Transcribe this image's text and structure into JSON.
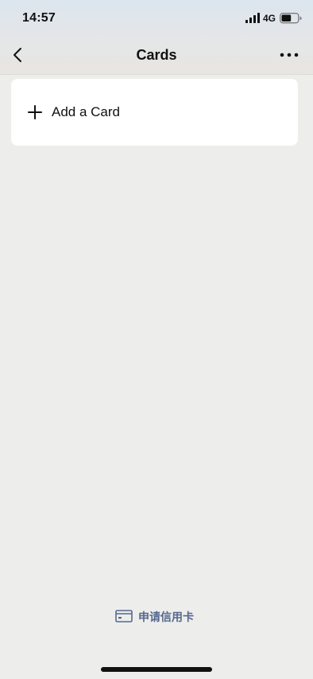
{
  "status_bar": {
    "time": "14:57",
    "network": "4G",
    "battery_level": 0.6
  },
  "nav": {
    "title": "Cards",
    "back_icon": "chevron-left-icon",
    "more_icon": "more-horizontal-icon"
  },
  "cards_panel": {
    "add_card_label": "Add a Card",
    "add_icon": "plus-icon"
  },
  "footer": {
    "apply_label": "申请信用卡",
    "apply_icon": "credit-card-icon",
    "accent_color": "#55698f"
  },
  "colors": {
    "background": "#ededeb",
    "card_background": "#ffffff"
  }
}
